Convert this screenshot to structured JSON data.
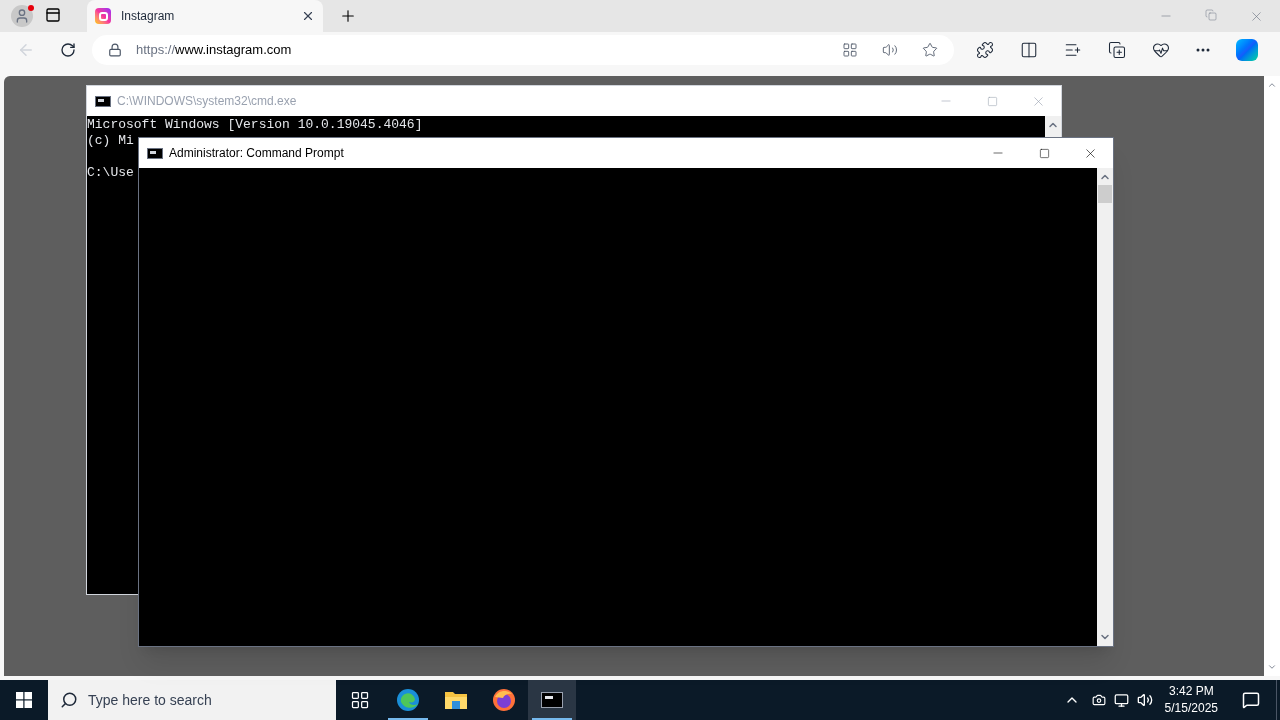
{
  "browser": {
    "tabs": [
      {
        "title": "Instagram",
        "selected": true
      }
    ],
    "address": {
      "scheme": "https://",
      "host": "www.instagram.com"
    },
    "profile_notification": true
  },
  "windows": [
    {
      "title": "C:\\WINDOWS\\system32\\cmd.exe",
      "active": false,
      "lines": [
        {
          "text": "Microsoft Windows [Version 10.0.19045.4046]",
          "gap_before": false
        },
        {
          "text": "(c) Mi",
          "gap_before": false
        },
        {
          "text": "C:\\Use",
          "gap_before": true
        }
      ]
    },
    {
      "title": "Administrator: Command Prompt",
      "active": true
    }
  ],
  "taskbar": {
    "search_placeholder": "Type here to search",
    "apps": [
      {
        "kind": "task-view",
        "running": false,
        "selected": false
      },
      {
        "kind": "edge",
        "running": true,
        "selected": false
      },
      {
        "kind": "explorer",
        "running": false,
        "selected": false
      },
      {
        "kind": "firefox",
        "running": false,
        "selected": false
      },
      {
        "kind": "terminal",
        "running": true,
        "selected": true
      }
    ],
    "time": "3:42 PM",
    "date": "5/15/2025"
  }
}
